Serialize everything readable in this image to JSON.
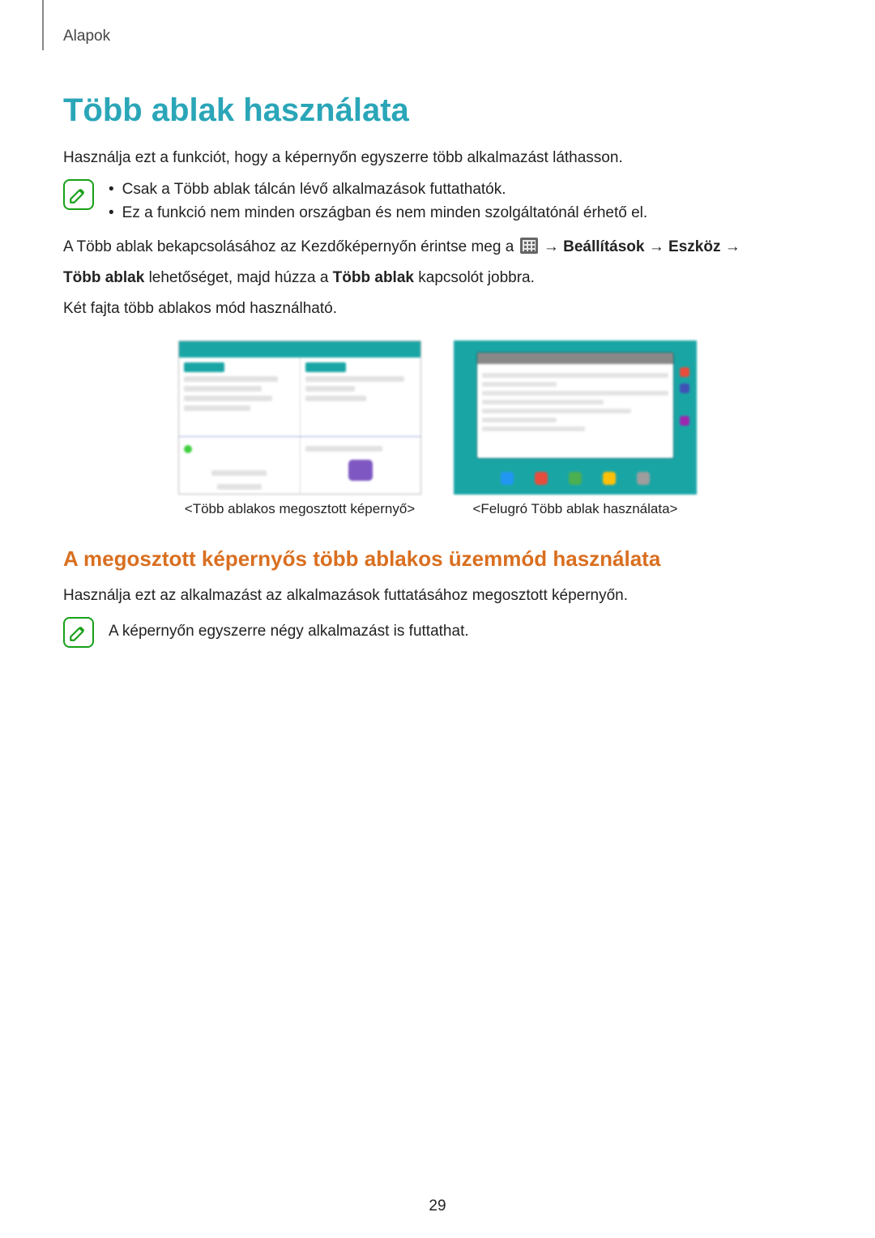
{
  "section_label": "Alapok",
  "title": "Több ablak használata",
  "intro": "Használja ezt a funkciót, hogy a képernyőn egyszerre több alkalmazást láthasson.",
  "note1": {
    "items": [
      "Csak a Több ablak tálcán lévő alkalmazások futtathatók.",
      "Ez a funkció nem minden országban és nem minden szolgáltatónál érhető el."
    ]
  },
  "enable_pre": "A Több ablak bekapcsolásához az Kezdőképernyőn érintse meg a ",
  "enable_arrow": " → ",
  "enable_b1": "Beállítások",
  "enable_b2": "Eszköz",
  "enable_line2_pre": "Több ablak",
  "enable_line2_mid": " lehetőséget, majd húzza a ",
  "enable_line2_b": "Több ablak",
  "enable_line2_post": " kapcsolót jobbra.",
  "two_modes": "Két fajta több ablakos mód használható.",
  "caption_a": "<Több ablakos megosztott képernyő>",
  "caption_b": "<Felugró Több ablak használata>",
  "subheading": "A megosztott képernyős több ablakos üzemmód használata",
  "sub_intro": "Használja ezt az alkalmazást az alkalmazások futtatásához megosztott képernyőn.",
  "note2": "A képernyőn egyszerre négy alkalmazást is futtathat.",
  "page_number": "29"
}
